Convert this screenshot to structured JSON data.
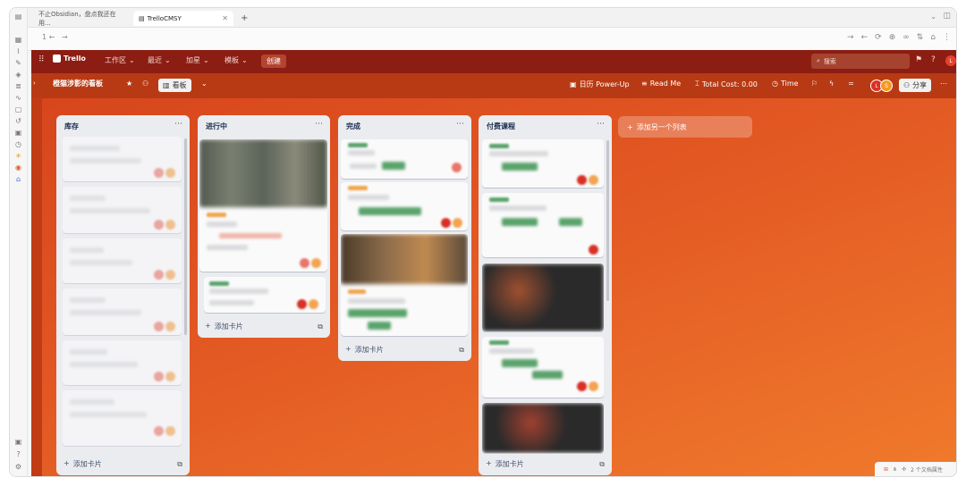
{
  "browser": {
    "tabs": [
      {
        "title": "不止Obsidian，盘点我还在用..."
      },
      {
        "title": "TrelloCMSY"
      }
    ],
    "new_tab": "+",
    "nav_back_count": "1 ←",
    "nav_forward": "→"
  },
  "trello_header": {
    "logo": "Trello",
    "workspace": "工作区",
    "recent": "最近",
    "starred": "加星",
    "templates": "模板",
    "create": "创建",
    "search_placeholder": "搜索",
    "user_initial": "L"
  },
  "board_bar": {
    "title": "橙猫涉影的看板",
    "view": "看板",
    "calendar_powerup": "日历 Power-Up",
    "read_me": "Read Me",
    "total_cost": "Total Cost: 0.00",
    "time": "Time",
    "share": "分享",
    "avatar_l": "L",
    "avatar_s": "S"
  },
  "lists": [
    {
      "title": "库存",
      "add_card": "添加卡片"
    },
    {
      "title": "进行中",
      "add_card": "添加卡片"
    },
    {
      "title": "完成",
      "add_card": "添加卡片"
    },
    {
      "title": "付费课程",
      "add_card": "添加卡片"
    }
  ],
  "add_list": "添加另一个列表",
  "corner_text": "2 个文档属性",
  "colors": {
    "header": "#8c1d12",
    "board_bar": "#b83a14",
    "board_gradient_start": "#d6441c",
    "board_gradient_end": "#f07a2c",
    "list_bg": "#ebecf0"
  }
}
